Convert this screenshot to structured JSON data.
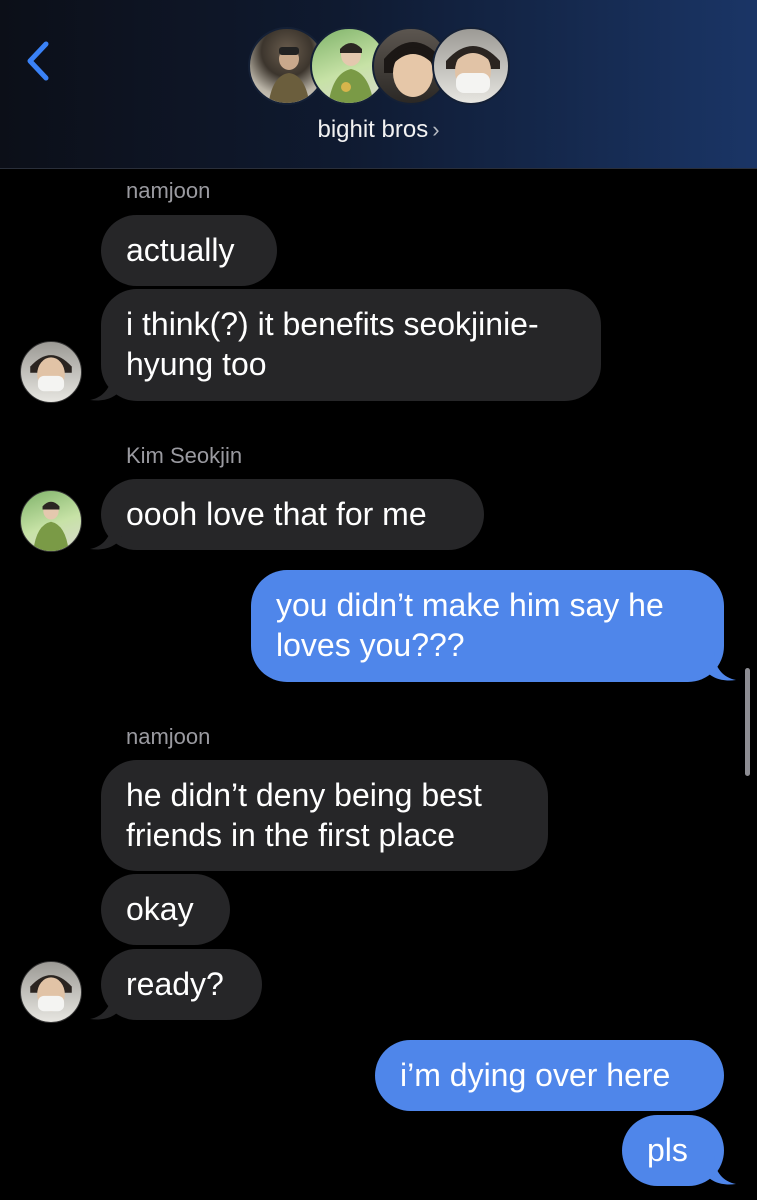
{
  "header": {
    "group_name": "bighit bros",
    "chevron": "›",
    "back_icon": "chevron-left-icon"
  },
  "colors": {
    "incoming_bubble": "#262628",
    "outgoing_bubble": "#4f86ea",
    "back_accent": "#3a82f7",
    "sender_label": "#9a9aa0"
  },
  "messages": [
    {
      "sender": "namjoon",
      "text": "actually"
    },
    {
      "text_line1": "i think(?) it benefits seokjinie-",
      "text_line2": "hyung too"
    },
    {
      "sender": "Kim Seokjin",
      "text": "oooh love that for me"
    },
    {
      "text_line1": "you didn’t make him say he",
      "text_line2": "loves you???"
    },
    {
      "sender": "namjoon",
      "text_line1": "he didn’t deny being best",
      "text_line2": "friends in the first place"
    },
    {
      "text": "okay"
    },
    {
      "text": "ready?"
    },
    {
      "text": "i’m dying over here"
    },
    {
      "text": "pls"
    }
  ]
}
